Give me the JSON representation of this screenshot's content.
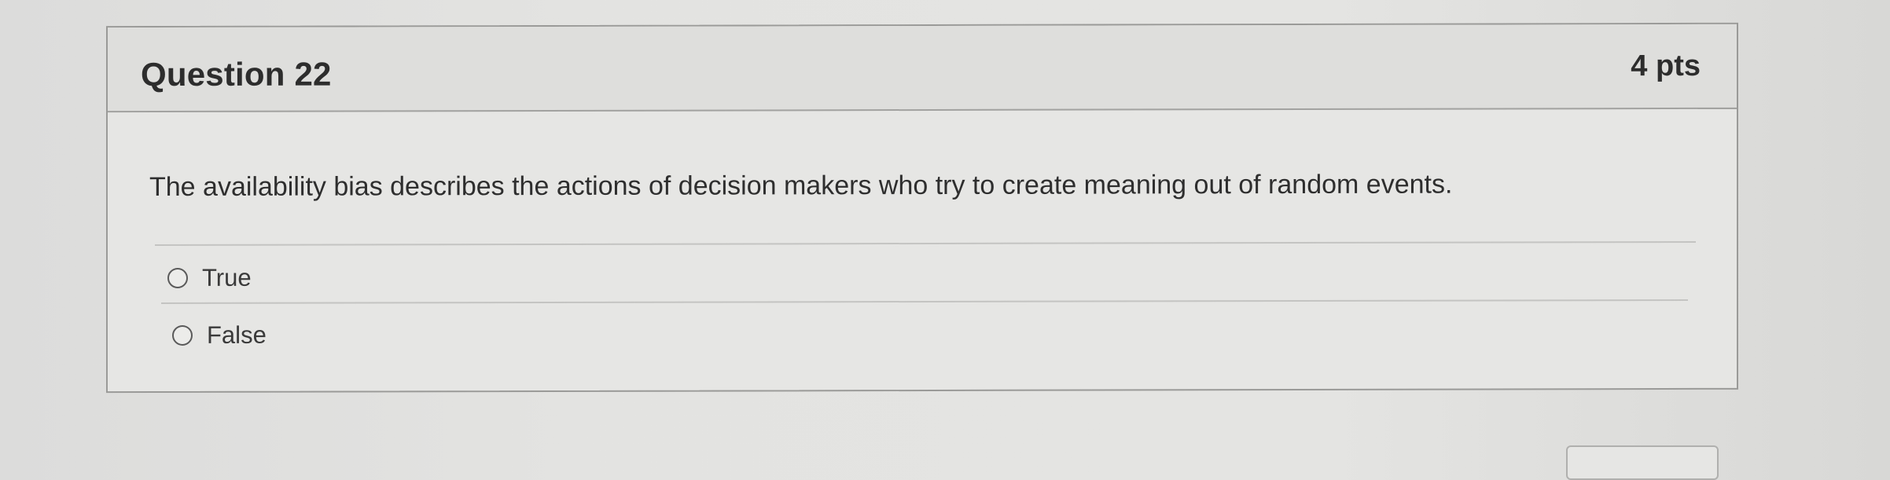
{
  "question": {
    "title": "Question 22",
    "points": "4 pts",
    "text": "The availability bias describes the actions of decision makers who try to create meaning out of random events.",
    "answers": [
      {
        "label": "True",
        "selected": false
      },
      {
        "label": "False",
        "selected": false
      }
    ]
  }
}
